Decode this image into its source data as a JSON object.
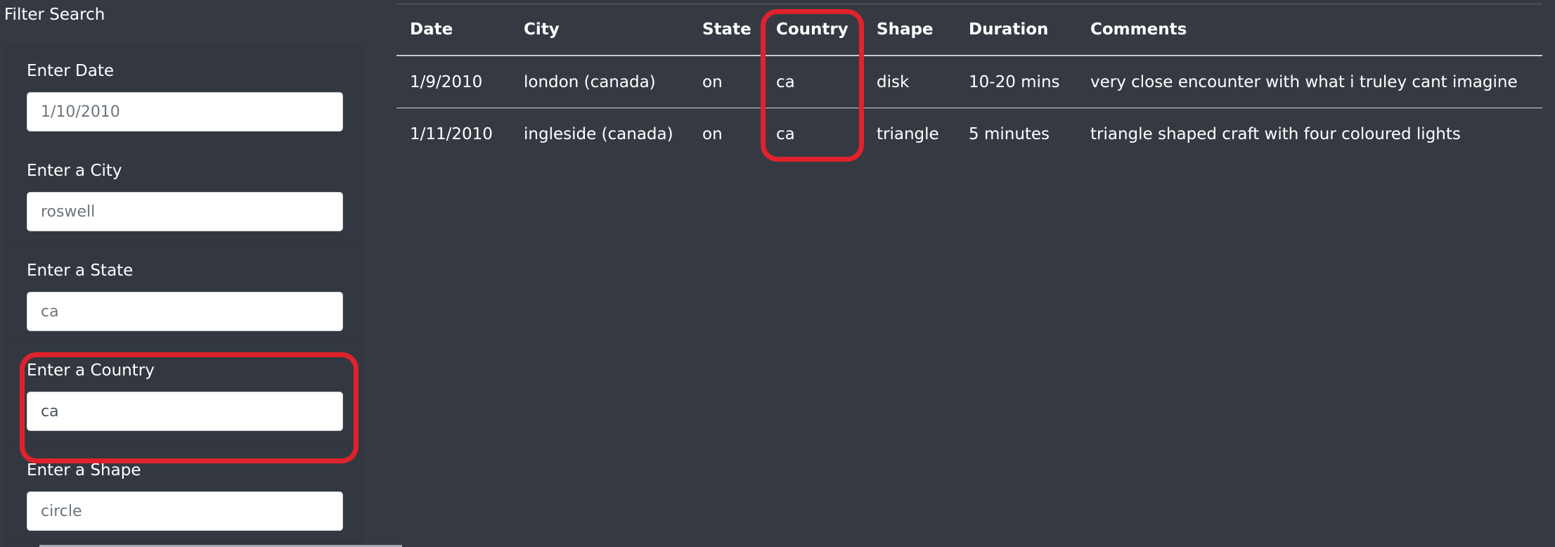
{
  "sidebar": {
    "title": "Filter Search",
    "filters": [
      {
        "label": "Enter Date",
        "placeholder": "1/10/2010",
        "value": ""
      },
      {
        "label": "Enter a City",
        "placeholder": "roswell",
        "value": ""
      },
      {
        "label": "Enter a State",
        "placeholder": "ca",
        "value": ""
      },
      {
        "label": "Enter a Country",
        "placeholder": "",
        "value": "ca"
      },
      {
        "label": "Enter a Shape",
        "placeholder": "circle",
        "value": ""
      }
    ]
  },
  "table": {
    "headers": [
      "Date",
      "City",
      "State",
      "Country",
      "Shape",
      "Duration",
      "Comments"
    ],
    "rows": [
      [
        "1/9/2010",
        "london (canada)",
        "on",
        "ca",
        "disk",
        "10-20 mins",
        "very close encounter with what i truley cant imagine"
      ],
      [
        "1/11/2010",
        "ingleside (canada)",
        "on",
        "ca",
        "triangle",
        "5 minutes",
        "triangle shaped craft with four coloured lights"
      ]
    ]
  },
  "colors": {
    "background": "#353a42",
    "highlight": "#e0222d"
  }
}
